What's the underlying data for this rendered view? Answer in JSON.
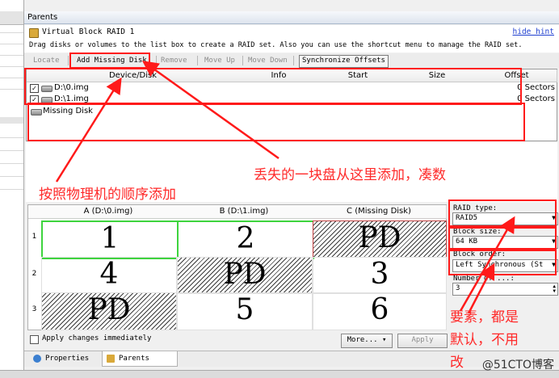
{
  "panel": {
    "header": "Parents"
  },
  "window": {
    "title": "Virtual Block RAID 1",
    "hide_hint": "hide hint",
    "description": "Drag disks or volumes to the list box to create a RAID set. Also you can use the shortcut menu to manage the RAID set."
  },
  "toolbar": {
    "locate": "Locate",
    "add_missing": "Add Missing Disk",
    "remove": "Remove",
    "move_up": "Move Up",
    "move_down": "Move Down",
    "sync": "Synchronize Offsets"
  },
  "device_list": {
    "columns": [
      "Device/Disk",
      "Info",
      "Start",
      "Size",
      "Offset"
    ],
    "rows": [
      {
        "name": "D:\\0.img",
        "offset": "0 Sectors",
        "checked": true
      },
      {
        "name": "D:\\1.img",
        "offset": "0 Sectors",
        "checked": true
      }
    ],
    "missing_disk": "Missing Disk"
  },
  "grid": {
    "columns": [
      "A (D:\\0.img)",
      "B (D:\\1.img)",
      "C (Missing Disk)"
    ],
    "row_labels": [
      "1",
      "2",
      "3"
    ],
    "cells": [
      [
        "1",
        "2",
        "PD"
      ],
      [
        "4",
        "PD",
        "3"
      ],
      [
        "PD",
        "5",
        "6"
      ]
    ]
  },
  "settings": {
    "raid_type_label": "RAID type:",
    "raid_type_value": "RAID5",
    "block_size_label": "Block size:",
    "block_size_value": "64 KB",
    "block_order_label": "Block order:",
    "block_order_value": "Left Synchronous (St",
    "number_label": "Number of ...:",
    "number_value": "3"
  },
  "bottom": {
    "apply_immediately": "Apply changes immediately",
    "more": "More...",
    "apply": "Apply"
  },
  "tabs": [
    "Properties",
    "Parents"
  ],
  "annotations": {
    "missing_note": "丢失的一块盘从这里添加，凑数",
    "order_note": "按照物理机的顺序添加",
    "elements_note_1": "要素，都是",
    "elements_note_2": "默认，不用",
    "elements_note_3": "改"
  },
  "watermark": "@51CTO博客",
  "colors": {
    "annotation_red": "#ff1a1a",
    "highlight_green": "#3ed43e",
    "link_blue": "#1f3fd0"
  }
}
